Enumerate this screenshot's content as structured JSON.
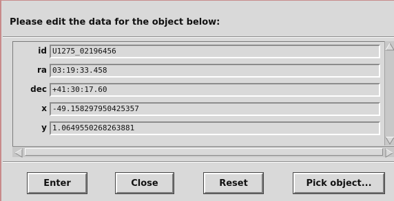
{
  "dialog": {
    "heading": "Please edit the data for the object below:"
  },
  "fields": [
    {
      "label": "id",
      "value": "U1275_02196456"
    },
    {
      "label": "ra",
      "value": "03:19:33.458"
    },
    {
      "label": "dec",
      "value": "+41:30:17.60"
    },
    {
      "label": "x",
      "value": "-49.158297950425357"
    },
    {
      "label": "y",
      "value": "1.0649550268263881"
    }
  ],
  "buttons": {
    "enter": "Enter",
    "close": "Close",
    "reset": "Reset",
    "pick": "Pick object..."
  },
  "icons": {
    "scroll_up": "triangle-up-icon",
    "scroll_down": "triangle-down-icon",
    "scroll_left": "triangle-left-icon",
    "scroll_right": "triangle-right-icon"
  }
}
